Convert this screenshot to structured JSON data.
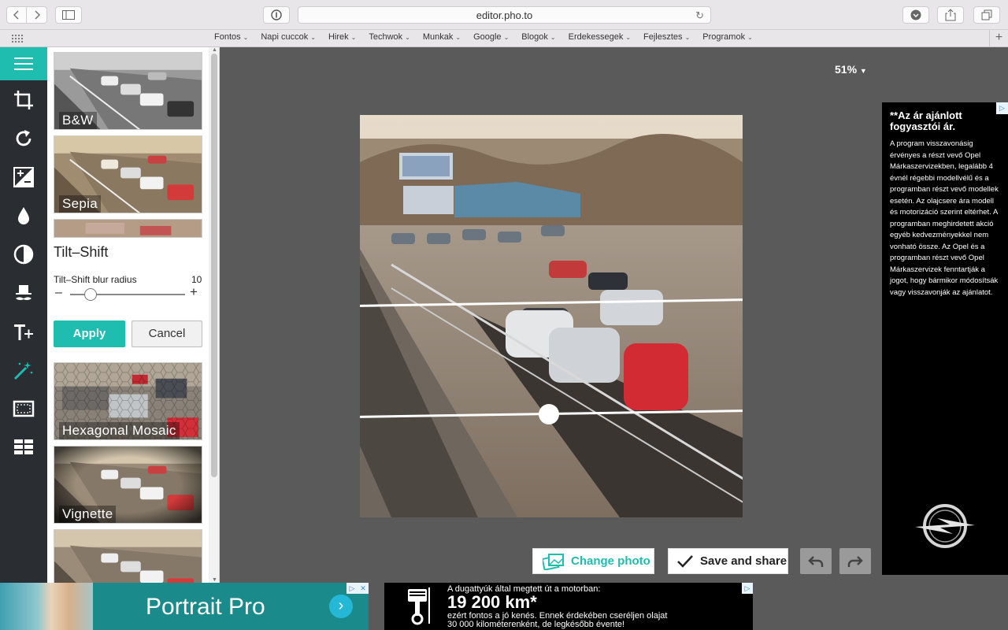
{
  "browser": {
    "url": "editor.pho.to",
    "bookmarks": [
      "Fontos",
      "Napi cuccok",
      "Hirek",
      "Techwok",
      "Munkak",
      "Google",
      "Blogok",
      "Erdekessegek",
      "Fejlesztes",
      "Programok"
    ]
  },
  "rail": {
    "items": [
      "menu-icon",
      "crop-icon",
      "rotate-icon",
      "exposure-icon",
      "color-icon",
      "contrast-icon",
      "retouch-icon",
      "text-icon",
      "effects-icon",
      "frames-icon",
      "textures-icon"
    ]
  },
  "panel": {
    "thumbnails_top": [
      {
        "label": "B&W"
      },
      {
        "label": "Sepia"
      }
    ],
    "tilt_shift": {
      "title": "Tilt–Shift",
      "blur_label": "Tilt–Shift blur radius",
      "blur_value": "10",
      "blur_fraction": 0.18,
      "apply_label": "Apply",
      "cancel_label": "Cancel"
    },
    "thumbnails_bottom": [
      {
        "label": "Hexagonal Mosaic"
      },
      {
        "label": "Vignette"
      },
      {
        "label": ""
      }
    ]
  },
  "canvas": {
    "zoom": "51%",
    "change_photo_label": "Change photo",
    "save_share_label": "Save and share"
  },
  "right_ad": {
    "heading": "**Az ár ajánlott fogyasztói ár.",
    "body": "A program visszavonásig érvényes a részt vevő Opel Márkaszervizekben, legalább 4 évnél régebbi modellvélű és a programban részt vevő modellek esetén. Az olajcsere ára modell és motorizáció szerint eltérhet. A programban meghirdetett akció egyéb kedvezményekkel nem vonható össze. Az Opel és a programban részt vevő Opel Márkaszervizek fenntartják a jogot, hogy bármikor módosítsák vagy visszavonják az ajánlatot."
  },
  "bottom_ads": {
    "portrait_title": "Portrait Pro",
    "engine_line1": "A dugattyúk által megtett út a motorban:",
    "engine_big": "19 200 km*",
    "engine_line2": "ezért fontos a jó kenés. Ennek érdekében cseréljen olajat",
    "engine_line3": "30 000 kilométerenként, de legkésőbb évente!"
  },
  "colors": {
    "accent": "#1fbcb0",
    "rail_bg": "#2a2d32",
    "canvas_bg": "#5a5a5a"
  }
}
